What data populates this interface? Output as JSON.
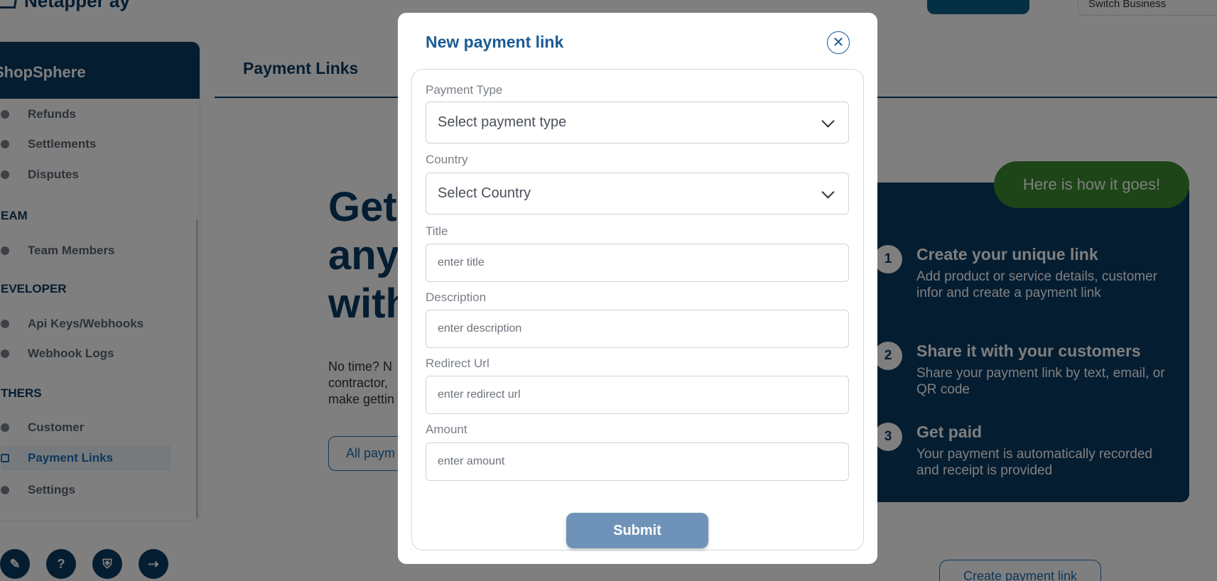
{
  "app": {
    "brand": "Netapper ay",
    "switch_business": "Switch Business"
  },
  "sidebar": {
    "business_name": "ShopSphere",
    "items": [
      {
        "label": "Refunds",
        "icon": "refund-icon"
      },
      {
        "label": "Settlements",
        "icon": "phone-icon"
      },
      {
        "label": "Disputes",
        "icon": "x-circle-icon"
      },
      {
        "label": "Team Members",
        "icon": "team-icon"
      },
      {
        "label": "Api Keys/Webhooks",
        "icon": "key-icon"
      },
      {
        "label": "Webhook Logs",
        "icon": "webhook-icon"
      },
      {
        "label": "Customer",
        "icon": "shield-check-icon"
      },
      {
        "label": "Payment Links",
        "icon": "card-icon"
      },
      {
        "label": "Settings",
        "icon": "gear-icon"
      }
    ],
    "sections": [
      "EAM",
      "EVELOPER",
      "THERS"
    ],
    "bottom_icons": [
      "document-icon",
      "help-icon",
      "shield-icon",
      "logout-icon"
    ]
  },
  "main": {
    "tab_title": "Payment Links",
    "hero_title": [
      "Get",
      "any",
      "with"
    ],
    "hero_text": [
      "No time? N",
      "contractor,",
      "make gettin"
    ],
    "all_payments_button": "All paym",
    "how_pill": "Here is how it goes!",
    "steps": [
      {
        "num": "1",
        "title": "Create your unique link",
        "desc": "Add product or service details, customer infor and create a payment link"
      },
      {
        "num": "2",
        "title": "Share it with your customers",
        "desc": "Share your payment link by text, email, or QR code"
      },
      {
        "num": "3",
        "title": "Get paid",
        "desc": "Your payment is automatically recorded and receipt is provided"
      }
    ],
    "create_link_button": "Create payment link"
  },
  "modal": {
    "title": "New payment link",
    "fields": {
      "payment_type": {
        "label": "Payment Type",
        "placeholder": "Select payment type"
      },
      "country": {
        "label": "Country",
        "placeholder": "Select Country"
      },
      "title": {
        "label": "Title",
        "placeholder": "enter title"
      },
      "description": {
        "label": "Description",
        "placeholder": "enter description"
      },
      "redirect_url": {
        "label": "Redirect Url",
        "placeholder": "enter redirect url"
      },
      "amount": {
        "label": "Amount",
        "placeholder": "enter amount"
      }
    },
    "submit": "Submit"
  },
  "colors": {
    "brand": "#0b3a63",
    "accent": "#1f6fb3",
    "submit": "#6f93b8",
    "pill": "#3b8a2e"
  }
}
